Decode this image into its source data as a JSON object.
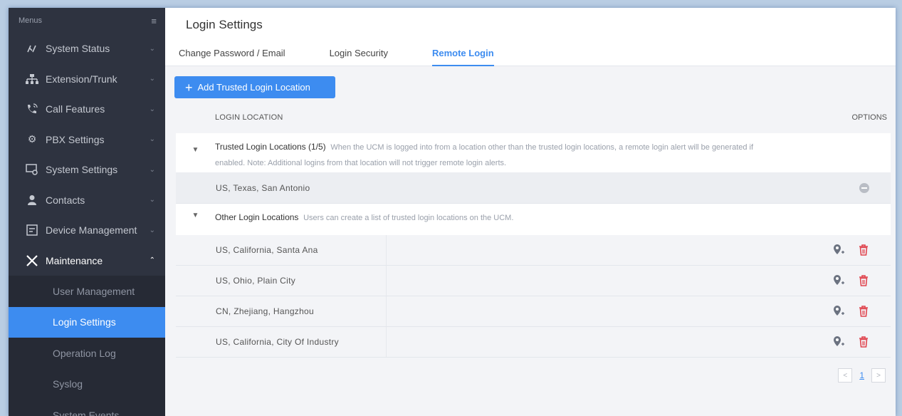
{
  "sidebar": {
    "header": "Menus",
    "items": [
      {
        "label": "System Status",
        "icon": "gauge-icon"
      },
      {
        "label": "Extension/Trunk",
        "icon": "network-icon"
      },
      {
        "label": "Call Features",
        "icon": "phone-icon"
      },
      {
        "label": "PBX Settings",
        "icon": "gear-icon"
      },
      {
        "label": "System Settings",
        "icon": "settings-panel-icon"
      },
      {
        "label": "Contacts",
        "icon": "person-icon"
      },
      {
        "label": "Device Management",
        "icon": "device-icon"
      },
      {
        "label": "Maintenance",
        "icon": "tools-icon"
      }
    ],
    "sub_items": [
      {
        "label": "User Management"
      },
      {
        "label": "Login Settings"
      },
      {
        "label": "Operation Log"
      },
      {
        "label": "Syslog"
      },
      {
        "label": "System Events"
      }
    ]
  },
  "page": {
    "title": "Login Settings",
    "tabs": [
      "Change Password / Email",
      "Login Security",
      "Remote Login"
    ],
    "active_tab": "Remote Login"
  },
  "actions": {
    "add_button": "Add Trusted Login Location"
  },
  "table": {
    "col_location": "LOGIN LOCATION",
    "col_options": "OPTIONS",
    "trusted_group": {
      "title": "Trusted Login Locations (1/5)",
      "description": "When the UCM is logged into from a location other than the trusted login locations, a remote login alert will be generated if enabled. Note: Additional logins from that location will not trigger remote login alerts.",
      "rows": [
        "US, Texas, San Antonio"
      ]
    },
    "other_group": {
      "title": "Other Login Locations",
      "description": "Users can create a list of trusted login locations on the UCM.",
      "rows": [
        "US, California, Santa Ana",
        "US, Ohio, Plain City",
        "CN, Zhejiang, Hangzhou",
        "US, California, City Of Industry"
      ]
    }
  },
  "pagination": {
    "current": "1",
    "prev": "<",
    "next": ">"
  },
  "colors": {
    "accent": "#3d8cf0",
    "sidebar": "#2e3340",
    "danger": "#e0454f"
  }
}
